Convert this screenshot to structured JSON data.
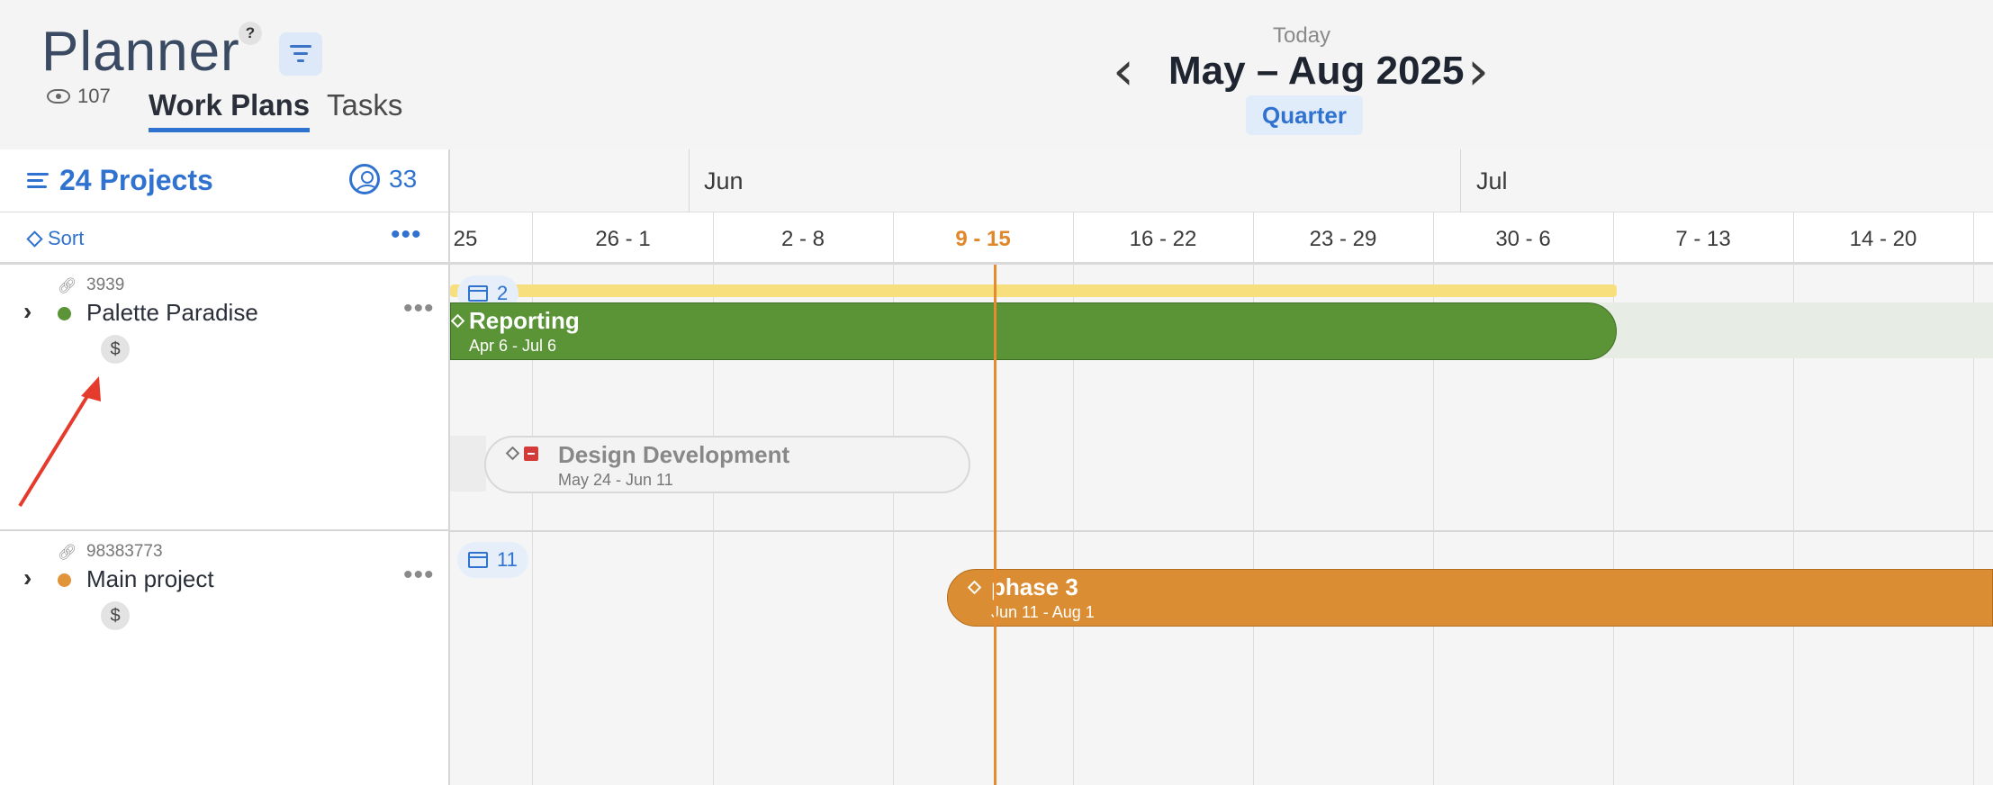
{
  "header": {
    "title": "Planner",
    "help": "?",
    "views_count": "107",
    "tabs": [
      {
        "label": "Work Plans",
        "active": true
      },
      {
        "label": "Tasks",
        "active": false
      }
    ],
    "today_label": "Today",
    "date_range": "May – Aug 2025",
    "prev_icon": "‹",
    "next_icon": "›",
    "zoom_label": "Quarter"
  },
  "left_panel": {
    "projects_label": "24 Projects",
    "members_count": "33",
    "sort_label": "Sort",
    "more": "•••",
    "projects": [
      {
        "id": "3939",
        "name": "Palette Paradise",
        "status_color": "#5a9437",
        "currency": "$",
        "more": "•••",
        "link_icon": "link-icon"
      },
      {
        "id": "98383773",
        "name": "Main project",
        "status_color": "#e0953a",
        "currency": "$",
        "more": "•••",
        "link_icon": "unlink-icon"
      }
    ]
  },
  "timeline": {
    "months": [
      "Jun",
      "Jul"
    ],
    "weeks": [
      "25",
      "26 - 1",
      "2 - 8",
      "9 - 15",
      "16 - 22",
      "23 - 29",
      "30 - 6",
      "7 - 13",
      "14 - 20"
    ],
    "current_week": "9 - 15",
    "rows": [
      {
        "chip_count": "2",
        "bars": [
          {
            "title": "Reporting",
            "dates": "Apr 6 - Jul 6",
            "color": "#5a9437"
          },
          {
            "title": "Design Development",
            "dates": "May 24 - Jun 11",
            "color": "#f3f3f3",
            "archived": true
          }
        ]
      },
      {
        "chip_count": "11",
        "bars": [
          {
            "title": "phase 3",
            "dates": "Jun 11 - Aug 1",
            "color": "#db8d33"
          }
        ]
      }
    ]
  },
  "colors": {
    "accent": "#2f72d0",
    "today": "#e58a2f",
    "annotation": "#e53b2c"
  }
}
